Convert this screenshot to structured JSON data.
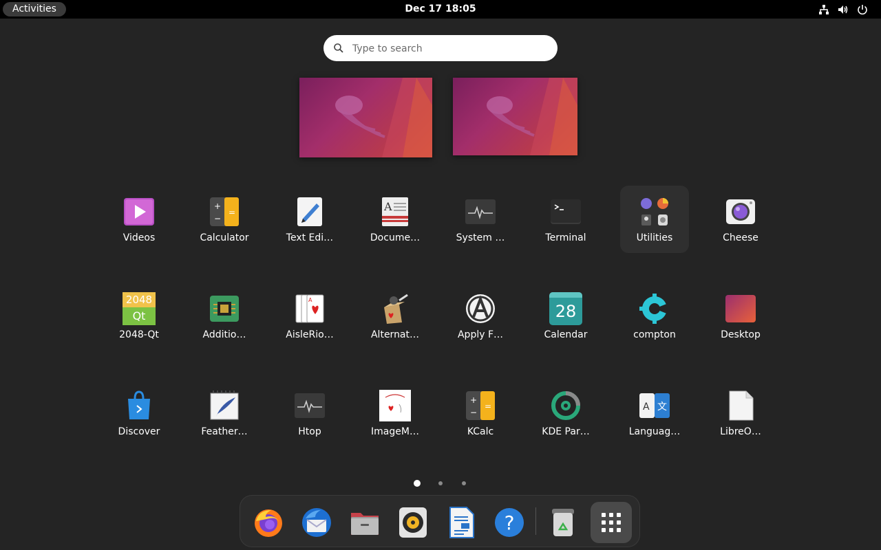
{
  "topbar": {
    "activities_label": "Activities",
    "clock": "Dec 17  18:05",
    "tray_icons": [
      "network-icon",
      "volume-icon",
      "power-icon"
    ]
  },
  "search": {
    "placeholder": "Type to search"
  },
  "workspaces": [
    "workspace-1",
    "workspace-2"
  ],
  "apps": [
    {
      "label": "Videos",
      "icon": "videos-icon"
    },
    {
      "label": "Calculator",
      "icon": "calculator-icon"
    },
    {
      "label": "Text Edi…",
      "icon": "text-editor-icon"
    },
    {
      "label": "Docume…",
      "icon": "document-viewer-icon"
    },
    {
      "label": "System …",
      "icon": "system-monitor-icon"
    },
    {
      "label": "Terminal",
      "icon": "terminal-icon"
    },
    {
      "label": "Utilities",
      "icon": "utilities-folder-icon"
    },
    {
      "label": "Cheese",
      "icon": "cheese-icon"
    },
    {
      "label": "2048-Qt",
      "icon": "2048-icon"
    },
    {
      "label": "Additio…",
      "icon": "additional-drivers-icon"
    },
    {
      "label": "AisleRio…",
      "icon": "aisleriot-icon"
    },
    {
      "label": "Alternat…",
      "icon": "alternatives-icon"
    },
    {
      "label": "Apply F…",
      "icon": "apply-icon"
    },
    {
      "label": "Calendar",
      "icon": "calendar-icon"
    },
    {
      "label": "compton",
      "icon": "compton-icon"
    },
    {
      "label": "Desktop",
      "icon": "desktop-icon"
    },
    {
      "label": "Discover",
      "icon": "discover-icon"
    },
    {
      "label": "Feather…",
      "icon": "feather-icon"
    },
    {
      "label": "Htop",
      "icon": "htop-icon"
    },
    {
      "label": "ImageM…",
      "icon": "imagemagick-icon"
    },
    {
      "label": "KCalc",
      "icon": "kcalc-icon"
    },
    {
      "label": "KDE Par…",
      "icon": "kde-partition-icon"
    },
    {
      "label": "Languag…",
      "icon": "language-icon"
    },
    {
      "label": "LibreO…",
      "icon": "libreoffice-icon"
    }
  ],
  "calendar_day": "28",
  "game_2048": {
    "top": "2048",
    "bottom": "Qt"
  },
  "page_dots": {
    "count": 3,
    "active": 0
  },
  "dock": [
    "firefox-icon",
    "thunderbird-icon",
    "files-icon",
    "rhythmbox-icon",
    "writer-icon",
    "help-icon",
    "trash-icon",
    "show-apps-icon"
  ],
  "colors": {
    "background": "#242424",
    "topbar": "#000000",
    "dock": "#2b2b2b"
  }
}
